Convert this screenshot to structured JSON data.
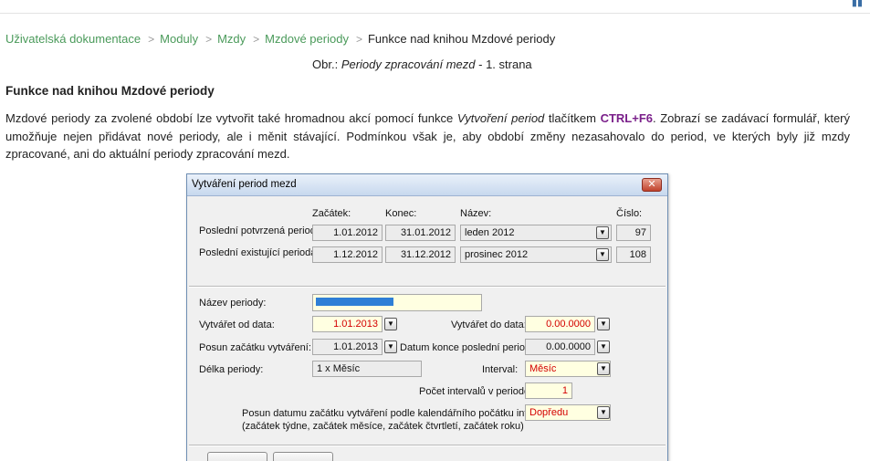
{
  "breadcrumb": {
    "items": [
      "Uživatelská dokumentace",
      "Moduly",
      "Mzdy",
      "Mzdové periody"
    ],
    "current": "Funkce nad knihou Mzdové periody"
  },
  "caption": {
    "prefix": "Obr.:",
    "italic": "Periody zpracování mezd",
    "suffix": "- 1. strana"
  },
  "section": {
    "heading": "Funkce nad knihou Mzdové periody",
    "para_a": "Mzdové periody za zvolené období lze vytvořit také hromadnou akcí pomocí funkce ",
    "para_func": "Vytvoření period",
    "para_b": " tlačítkem ",
    "para_key": "CTRL+F6",
    "para_c": ". Zobrazí se zadávací formulář, který umožňuje nejen přidávat nové periody, ale i měnit stávající. Podmínkou však je, aby období změny nezasahovalo do period, ve kterých byly již mzdy zpracované, ani do aktuální periody zpracování mezd."
  },
  "dialog": {
    "title": "Vytváření period mezd",
    "close": "✕",
    "headers": {
      "start": "Začátek:",
      "end": "Konec:",
      "name": "Název:",
      "number": "Číslo:"
    },
    "rows": [
      {
        "label": "Poslední potvrzená perioda:",
        "start": "1.01.2012",
        "end": "31.01.2012",
        "name": "leden 2012",
        "number": "97"
      },
      {
        "label": "Poslední existující perioda:",
        "start": "1.12.2012",
        "end": "31.12.2012",
        "name": "prosinec 2012",
        "number": "108"
      }
    ],
    "form": {
      "period_name_label": "Název periody:",
      "create_from_label": "Vytvářet od data:",
      "create_from_value": "1.01.2013",
      "create_to_label": "Vytvářet do data:",
      "create_to_value": "0.00.0000",
      "shift_start_label": "Posun začátku vytváření:",
      "shift_start_value": "1.01.2013",
      "last_end_label": "Datum konce poslední periody:",
      "last_end_value": "0.00.0000",
      "length_label": "Délka periody:",
      "length_value": "1 x Měsíc",
      "interval_label": "Interval:",
      "interval_value": "Měsíc",
      "count_label": "Počet intervalů v periodě:",
      "count_value": "1",
      "shift_label_1": "Posun datumu začátku vytváření podle kalendářního počátku intervalu:",
      "shift_label_2": "(začátek týdne, začátek měsíce, začátek čtvrtletí, začátek roku)",
      "shift_value": "Dopředu"
    },
    "dropdown_glyph": "▼"
  },
  "colors": {
    "link": "#4a9a5a",
    "key": "#7a1f8a",
    "red_value": "#d40000",
    "selection": "#2f7fd6"
  }
}
